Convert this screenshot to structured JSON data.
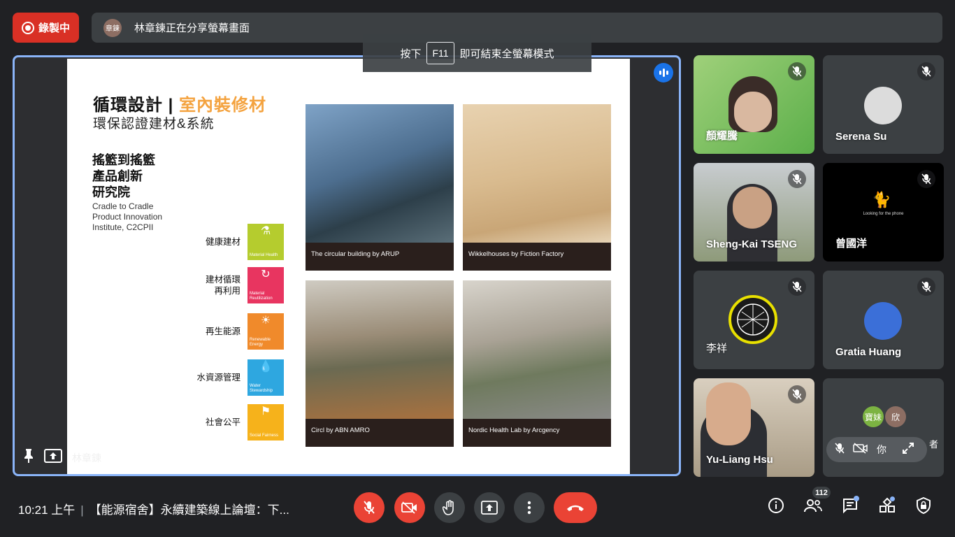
{
  "recording": {
    "label": "錄製中"
  },
  "presenter_bar": {
    "avatar_text": "章鍊",
    "message": "林章鍊正在分享螢幕畫面"
  },
  "fullscreen_hint": {
    "prefix": "按下",
    "key": "F11",
    "suffix": "即可結束全螢幕模式"
  },
  "slide": {
    "title_main": "循環設計 | ",
    "title_accent": "室內裝修材",
    "subtitle": "環保認證建材&系統",
    "institute_zh": [
      "搖籃到搖籃",
      "產品創新",
      "研究院"
    ],
    "institute_en": [
      "Cradle to Cradle",
      "Product Innovation",
      "Institute, C2CPII"
    ],
    "categories": [
      {
        "label": "健康建材",
        "tile": "Material Health",
        "color": "#b5cc2e",
        "icon": "⚗"
      },
      {
        "label": "建材循環再利用",
        "tile": "Material Reutilization",
        "color": "#e83560",
        "icon": "↻"
      },
      {
        "label": "再生能源",
        "tile": "Renewable Energy",
        "color": "#f08a2b",
        "icon": "☀"
      },
      {
        "label": "水資源管理",
        "tile": "Water Stewardship",
        "color": "#2ea7e0",
        "icon": "💧"
      },
      {
        "label": "社會公平",
        "tile": "Social Fairness",
        "color": "#f6b21b",
        "icon": "⚑"
      }
    ],
    "photos": [
      {
        "caption": "The circular building by ARUP"
      },
      {
        "caption": "Wikkelhouses by Fiction Factory"
      },
      {
        "caption": "Circl by ABN AMRO"
      },
      {
        "caption": "Nordic Health Lab by Arcgency"
      }
    ]
  },
  "stage": {
    "presenter_name": "林章鍊"
  },
  "participants": [
    {
      "name": "顏耀騰"
    },
    {
      "name": "Serena Su"
    },
    {
      "name": "Sheng-Kai TSENG"
    },
    {
      "name": "曾國洋",
      "screen_text": "Looking for the phone"
    },
    {
      "name": "李祥"
    },
    {
      "name": "Gratia Huang"
    },
    {
      "name": "Yu-Liang Hsu"
    },
    {
      "name": "你",
      "avatars": [
        "寶妹",
        "欣"
      ],
      "extra": "者"
    }
  ],
  "bottom": {
    "time": "10:21 上午",
    "meeting_title": "【能源宿舍】永續建築線上論壇：下...",
    "participant_count": "112"
  }
}
